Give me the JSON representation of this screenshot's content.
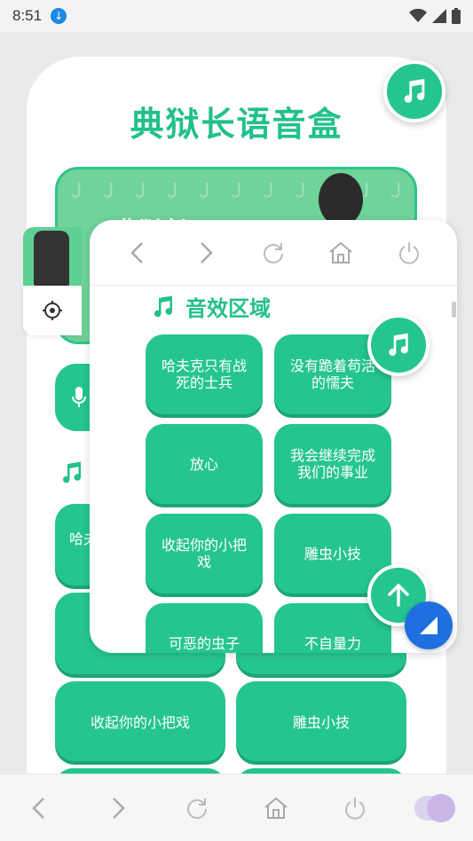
{
  "status_bar": {
    "time": "8:51"
  },
  "app": {
    "title": "典狱长语音盒",
    "banner_text": "典狱长",
    "background_label": "哈夫",
    "background_rows": [
      {
        "left": "收起你的小把戏",
        "right": "雕虫小技"
      }
    ]
  },
  "floating_window": {
    "section_title": "音效区域",
    "sound_buttons": [
      "哈夫克只有战死的士兵",
      "没有跪着苟活的懦夫",
      "放心",
      "我会继续完成我们的事业",
      "收起你的小把戏",
      "雕虫小技",
      "可恶的虫子",
      "不自量力"
    ]
  },
  "colors": {
    "accent": "#25c58e",
    "title_green": "#22c08a",
    "resize_blue": "#1f6fe0"
  },
  "icons": [
    "download-icon",
    "wifi-icon",
    "signal-icon",
    "battery-icon",
    "music-note-icon",
    "back-icon",
    "forward-icon",
    "refresh-icon",
    "home-icon",
    "power-icon",
    "gear-icon",
    "mic-icon",
    "arrow-up-icon",
    "resize-icon",
    "toggle-icon"
  ]
}
